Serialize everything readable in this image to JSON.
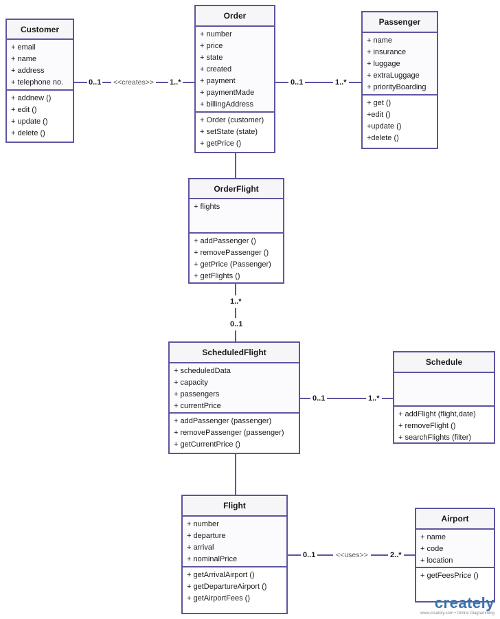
{
  "classes": {
    "customer": {
      "name": "Customer",
      "attributes": [
        "+ email",
        "+ name",
        "+ address",
        "+ telephone no."
      ],
      "methods": [
        "+ addnew ()",
        "+ edit ()",
        "+ update ()",
        "+ delete ()"
      ]
    },
    "order": {
      "name": "Order",
      "attributes": [
        "+ number",
        "+ price",
        "+ state",
        "+ created",
        "+ payment",
        "+ paymentMade",
        "+ billingAddress"
      ],
      "methods": [
        "+ Order (customer)",
        "+ setState (state)",
        "+ getPrice ()"
      ]
    },
    "passenger": {
      "name": "Passenger",
      "attributes": [
        "+ name",
        "+ insurance",
        "+ luggage",
        "+ extraLuggage",
        "+ priorityBoarding"
      ],
      "methods": [
        "+ get ()",
        "+edit ()",
        "+update ()",
        "+delete ()"
      ]
    },
    "orderflight": {
      "name": "OrderFlight",
      "attributes": [
        "+ flights"
      ],
      "methods": [
        "+ addPassenger ()",
        "+ removePassenger ()",
        "+ getPrice (Passenger)",
        "+ getFlights ()"
      ]
    },
    "scheduledflight": {
      "name": "ScheduledFlight",
      "attributes": [
        "+ scheduledData",
        "+ capacity",
        "+ passengers",
        "+ currentPrice"
      ],
      "methods": [
        "+ addPassenger (passenger)",
        "+ removePassenger (passenger)",
        "+ getCurrentPrice ()"
      ]
    },
    "schedule": {
      "name": "Schedule",
      "attributes": [],
      "methods": [
        "+ addFlight (flight,date)",
        "+ removeFlight ()",
        "+ searchFlights (filter)"
      ]
    },
    "flight": {
      "name": "Flight",
      "attributes": [
        "+ number",
        "+ departure",
        "+ arrival",
        "+ nominalPrice"
      ],
      "methods": [
        "+ getArrivalAirport ()",
        "+ getDepartureAirport ()",
        "+ getAirportFees ()"
      ]
    },
    "airport": {
      "name": "Airport",
      "attributes": [
        "+ name",
        "+ code",
        "+ location"
      ],
      "methods": [
        "+ getFeesPrice ()"
      ]
    }
  },
  "associations": {
    "customer_order": {
      "from": "Customer",
      "to": "Order",
      "from_mult": "0..1",
      "to_mult": "1..*",
      "stereotype": "<<creates>>"
    },
    "order_passenger": {
      "from": "Order",
      "to": "Passenger",
      "from_mult": "0..1",
      "to_mult": "1..*"
    },
    "order_orderflight": {
      "from": "Order",
      "to": "OrderFlight"
    },
    "orderflight_scheduledflight": {
      "from": "OrderFlight",
      "to": "ScheduledFlight",
      "from_mult": "1..*",
      "to_mult": "0..1"
    },
    "scheduledflight_schedule": {
      "from": "ScheduledFlight",
      "to": "Schedule",
      "from_mult": "0..1",
      "to_mult": "1..*"
    },
    "scheduledflight_flight": {
      "from": "ScheduledFlight",
      "to": "Flight"
    },
    "flight_airport": {
      "from": "Flight",
      "to": "Airport",
      "from_mult": "0..1",
      "to_mult": "2..*",
      "stereotype": "<<uses>>"
    }
  },
  "watermark": {
    "brand": "creately",
    "tagline": "www.creately.com • Online Diagramming"
  }
}
